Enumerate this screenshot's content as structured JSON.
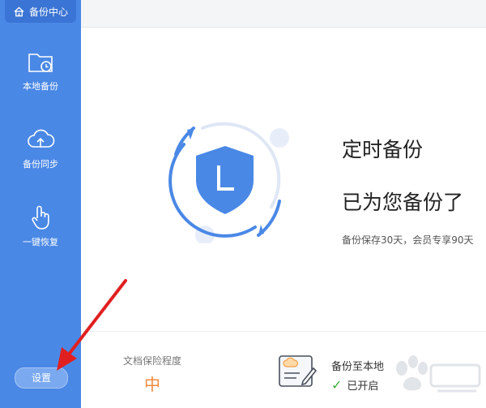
{
  "sidebar": {
    "home_label": "备份中心",
    "items": [
      {
        "label": "本地备份",
        "icon": "folder-clock-icon"
      },
      {
        "label": "备份同步",
        "icon": "cloud-upload-icon"
      },
      {
        "label": "一键恢复",
        "icon": "hand-pointer-icon"
      }
    ],
    "settings_label": "设置"
  },
  "hero": {
    "title": "定时备份",
    "status": "已为您备份了 ",
    "note": "备份保存30天，会员专享90天"
  },
  "bottom": {
    "level_label": "文档保险程度",
    "level_value": "中",
    "local_title": "备份至本地",
    "local_status": "已开启"
  },
  "colors": {
    "sidebar": "#4a88e6",
    "accent": "#4a88e6",
    "level": "#f08a3c",
    "check": "#3cb034",
    "annotation": "#e02020"
  }
}
